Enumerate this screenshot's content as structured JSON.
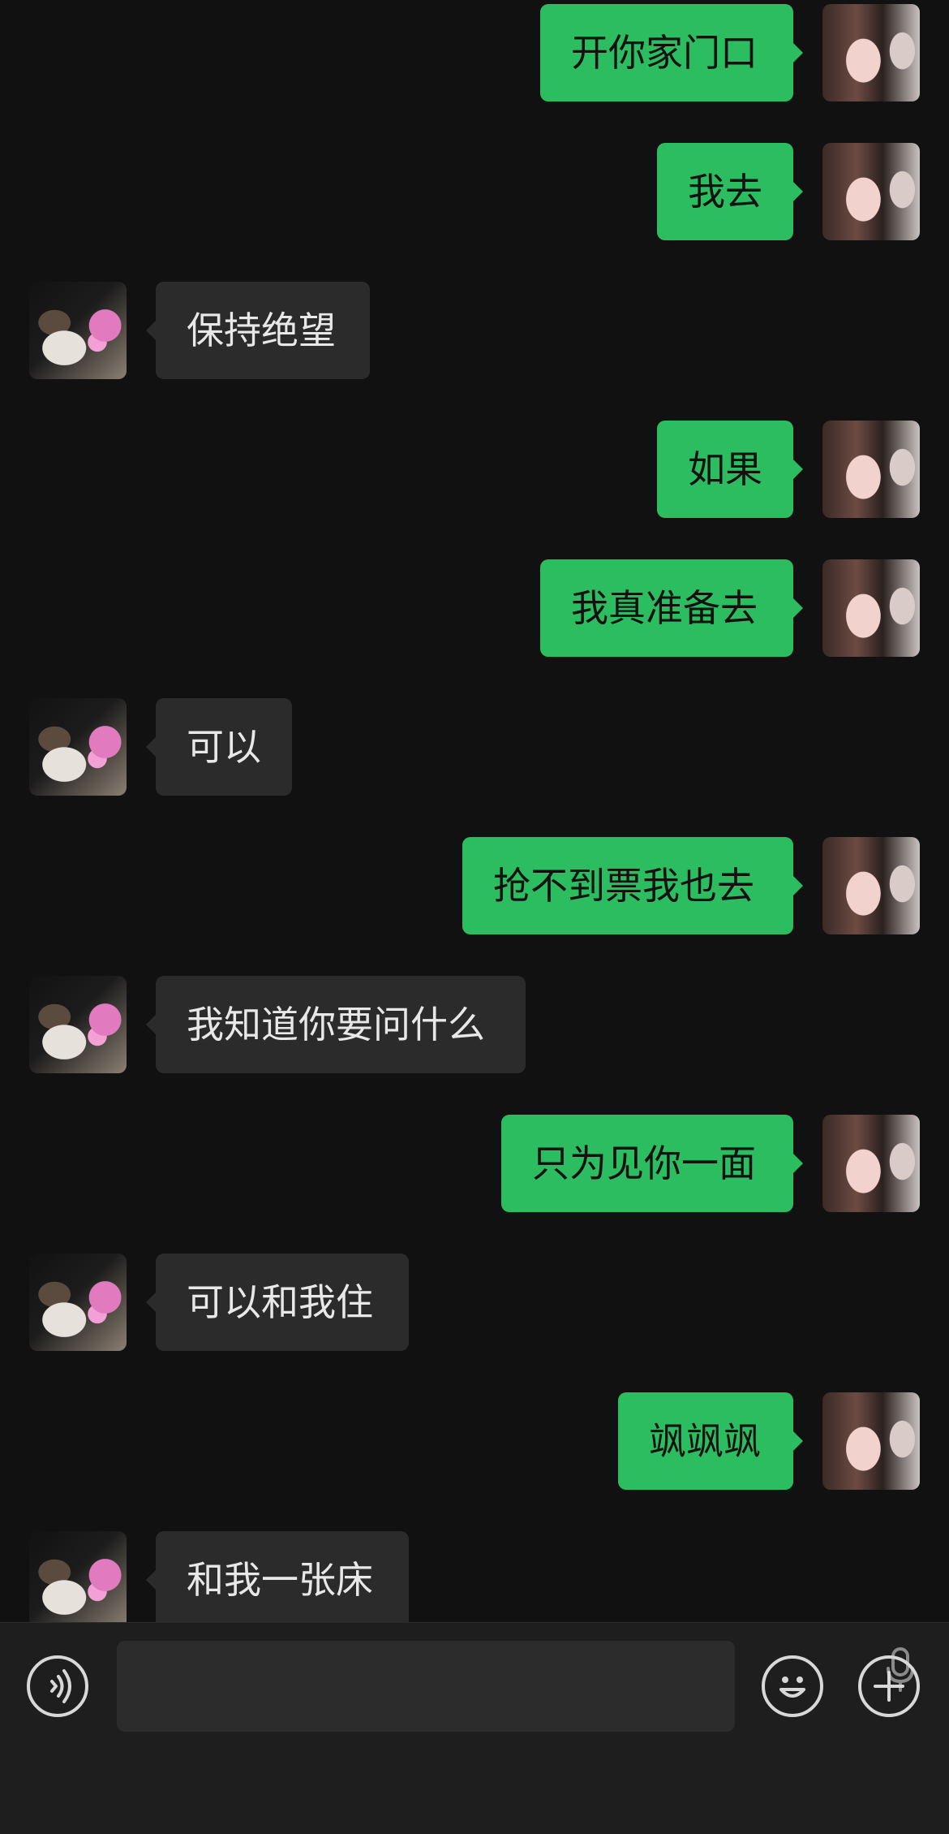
{
  "messages": [
    {
      "from": "me",
      "text": "开你家门口"
    },
    {
      "from": "me",
      "text": "我去"
    },
    {
      "from": "them",
      "text": "保持绝望"
    },
    {
      "from": "me",
      "text": "如果"
    },
    {
      "from": "me",
      "text": "我真准备去"
    },
    {
      "from": "them",
      "text": "可以"
    },
    {
      "from": "me",
      "text": "抢不到票我也去"
    },
    {
      "from": "them",
      "text": "我知道你要问什么"
    },
    {
      "from": "me",
      "text": "只为见你一面"
    },
    {
      "from": "them",
      "text": "可以和我住"
    },
    {
      "from": "me",
      "text": "飒飒飒"
    },
    {
      "from": "them",
      "text": "和我一张床"
    }
  ],
  "composer": {
    "input_value": "",
    "voice_icon": "voice-toggle-icon",
    "mic_icon": "microphone-icon",
    "emoji_icon": "emoji-icon",
    "plus_icon": "plus-icon"
  },
  "colors": {
    "background": "#111111",
    "sent_bubble": "#2bbd5f",
    "received_bubble": "#2b2b2b",
    "composer_bar": "#1e1e1e"
  }
}
